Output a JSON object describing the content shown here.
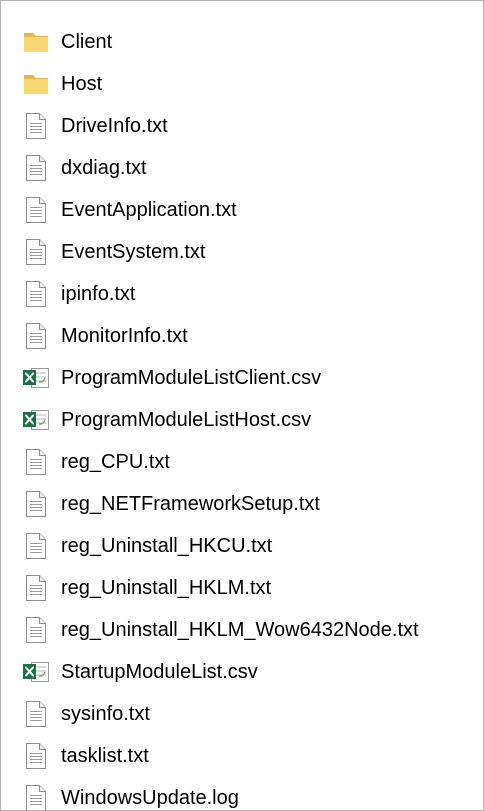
{
  "items": [
    {
      "name": "Client",
      "type": "folder"
    },
    {
      "name": "Host",
      "type": "folder"
    },
    {
      "name": "DriveInfo.txt",
      "type": "text"
    },
    {
      "name": "dxdiag.txt",
      "type": "text"
    },
    {
      "name": "EventApplication.txt",
      "type": "text"
    },
    {
      "name": "EventSystem.txt",
      "type": "text"
    },
    {
      "name": "ipinfo.txt",
      "type": "text"
    },
    {
      "name": "MonitorInfo.txt",
      "type": "text"
    },
    {
      "name": "ProgramModuleListClient.csv",
      "type": "csv"
    },
    {
      "name": "ProgramModuleListHost.csv",
      "type": "csv"
    },
    {
      "name": "reg_CPU.txt",
      "type": "text"
    },
    {
      "name": "reg_NETFrameworkSetup.txt",
      "type": "text"
    },
    {
      "name": "reg_Uninstall_HKCU.txt",
      "type": "text"
    },
    {
      "name": "reg_Uninstall_HKLM.txt",
      "type": "text"
    },
    {
      "name": "reg_Uninstall_HKLM_Wow6432Node.txt",
      "type": "text"
    },
    {
      "name": "StartupModuleList.csv",
      "type": "csv"
    },
    {
      "name": "sysinfo.txt",
      "type": "text"
    },
    {
      "name": "tasklist.txt",
      "type": "text"
    },
    {
      "name": "WindowsUpdate.log",
      "type": "text"
    }
  ],
  "icons": {
    "folder": "folder-icon",
    "text": "text-file-icon",
    "csv": "excel-csv-icon"
  },
  "colors": {
    "folder": "#f8d775",
    "folder_dark": "#e8b64a",
    "excel": "#1f7244",
    "text_icon_border": "#8c8c8c"
  }
}
